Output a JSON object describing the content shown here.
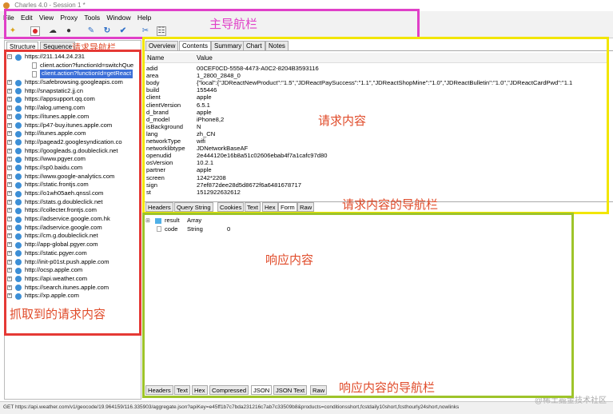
{
  "window": {
    "title": "Charles 4.0 - Session 1 *"
  },
  "menu": [
    "File",
    "Edit",
    "View",
    "Proxy",
    "Tools",
    "Window",
    "Help"
  ],
  "toolbar": {
    "icons": [
      "broom-icon",
      "record-icon",
      "throttle-icon",
      "breakpoint-icon",
      "pen-icon",
      "refresh-icon",
      "check-icon",
      "tools-icon",
      "settings-icon"
    ]
  },
  "annotations": {
    "main_nav": "主导航栏",
    "request_nav": "请求导航栏",
    "request_content": "请求内容",
    "request_content_nav": "请求内容的导航栏",
    "response_content": "响应内容",
    "captured_requests": "抓取到的请求内容",
    "response_content_nav": "响应内容的导航栏",
    "colors": {
      "magenta": "#e040c8",
      "yellow": "#f2e600",
      "red": "#e53935",
      "green": "#9ec42a"
    }
  },
  "left": {
    "tabs": [
      "Structure",
      "Sequence"
    ],
    "root": "https://211.144.24.231",
    "children": [
      "client.action?functionId=switchQue",
      "client.action?functionId=getReact"
    ],
    "hosts": [
      "https://safebrowsing.googleapis.com",
      "http://snapstatic2.jj.cn",
      "https://appsupport.qq.com",
      "http://alog.umeng.com",
      "https://itunes.apple.com",
      "https://p47-buy.itunes.apple.com",
      "http://itunes.apple.com",
      "http://pagead2.googlesyndication.co",
      "https://googleads.g.doubleclick.net",
      "https://www.pgyer.com",
      "https://sp0.baidu.com",
      "https://www.google-analytics.com",
      "https://static.frontjs.com",
      "https://o1wh05aeh.qnssl.com",
      "https://stats.g.doubleclick.net",
      "https://collecter.frontjs.com",
      "https://adservice.google.com.hk",
      "https://adservice.google.com",
      "https://cm.g.doubleclick.net",
      "http://app-global.pgyer.com",
      "https://static.pgyer.com",
      "http://init-p01st.push.apple.com",
      "http://ocsp.apple.com",
      "https://api.weather.com",
      "https://search.itunes.apple.com",
      "https://xp.apple.com"
    ]
  },
  "request": {
    "tabs": [
      "Overview",
      "Contents",
      "Summary",
      "Chart",
      "Notes"
    ],
    "active_tab": "Contents",
    "columns": [
      "Name",
      "Value"
    ],
    "rows": [
      {
        "k": "adid",
        "v": "00CEF0CD-5558-4473-A0C2-8204B3593116"
      },
      {
        "k": "area",
        "v": "1_2800_2848_0"
      },
      {
        "k": "body",
        "v": "{\"local\":{\"JDReactNewProduct\":\"1.5\",\"JDReactPaySuccess\":\"1.1\",\"JDReactShopMine\":\"1.0\",\"JDReactBulletin\":\"1.0\",\"JDReactCardPwd\":\"1.1"
      },
      {
        "k": "build",
        "v": "155446"
      },
      {
        "k": "client",
        "v": "apple"
      },
      {
        "k": "clientVersion",
        "v": "6.5.1"
      },
      {
        "k": "d_brand",
        "v": "apple"
      },
      {
        "k": "d_model",
        "v": "iPhone8,2"
      },
      {
        "k": "isBackground",
        "v": "N"
      },
      {
        "k": "lang",
        "v": "zh_CN"
      },
      {
        "k": "networkType",
        "v": "wifi"
      },
      {
        "k": "networklibtype",
        "v": "JDNetworkBaseAF"
      },
      {
        "k": "openudid",
        "v": "2e444120e16b8a51c02606ebab4f7a1cafc97d80"
      },
      {
        "k": "osVersion",
        "v": "10.2.1"
      },
      {
        "k": "partner",
        "v": "apple"
      },
      {
        "k": "screen",
        "v": "1242*2208"
      },
      {
        "k": "sign",
        "v": "27ef872dee28d5d8672f6a6481678717"
      },
      {
        "k": "st",
        "v": "1512922632612"
      }
    ],
    "bottom_tabs": [
      "Headers",
      "Query String",
      "Cookies",
      "Text",
      "Hex",
      "Form",
      "Raw"
    ],
    "bottom_active": "Form"
  },
  "response": {
    "tree": [
      {
        "name": "result",
        "type": "Array",
        "value": ""
      },
      {
        "name": "code",
        "type": "String",
        "value": "0"
      }
    ],
    "tabs": [
      "Headers",
      "Text",
      "Hex",
      "Compressed",
      "JSON",
      "JSON Text",
      "Raw"
    ],
    "active_tab": "JSON"
  },
  "status": "GET https://api.weather.com/v1/geocode/19.964159/116.335903/aggregate.json?apiKey=e45ff1b7c7bda231216c7ab7c33509b8&products=conditionsshort,fcstdaily10short,fcsthourly24short,nowlinks",
  "watermark": "@稀土掘金技术社区"
}
